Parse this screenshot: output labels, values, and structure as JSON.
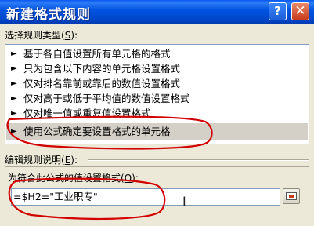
{
  "window": {
    "title": "新建格式规则",
    "help_glyph": "?",
    "close_glyph": "✕"
  },
  "rule_type": {
    "label_prefix": "选择规则类型(",
    "label_key": "S",
    "label_suffix": "):",
    "items": [
      {
        "arrow": "►",
        "text": "基于各自值设置所有单元格的格式"
      },
      {
        "arrow": "►",
        "text": "只为包含以下内容的单元格设置格式"
      },
      {
        "arrow": "►",
        "text": "仅对排名靠前或靠后的数值设置格式"
      },
      {
        "arrow": "►",
        "text": "仅对高于或低于平均值的数值设置格式"
      },
      {
        "arrow": "►",
        "text": "仅对唯一值或重复值设置格式"
      },
      {
        "arrow": "►",
        "text": "使用公式确定要设置格式的单元格",
        "selected": true
      }
    ]
  },
  "rule_description": {
    "label_prefix": "编辑规则说明(",
    "label_key": "E",
    "label_suffix": "):",
    "formula_label_prefix": "为符合此公式的值设置格式(",
    "formula_label_key": "O",
    "formula_label_suffix": "):",
    "formula_value": "=$H2=\"工业职专\""
  },
  "icons": {
    "arrow": "play-arrow-icon",
    "cursor": "text-cursor-icon",
    "refedit": "collapse-dialog-icon"
  },
  "colors": {
    "titlebar": "#0052e0",
    "dialog_bg": "#ece9d8",
    "selected_row": "#d4d0c8",
    "annotation": "#d40000"
  }
}
